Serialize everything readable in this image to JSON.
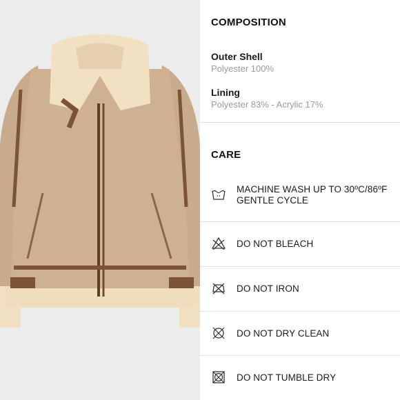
{
  "composition": {
    "title": "COMPOSITION",
    "items": [
      {
        "label": "Outer Shell",
        "value": "Polyester 100%"
      },
      {
        "label": "Lining",
        "value": "Polyester 83% - Acrylic 17%"
      }
    ]
  },
  "care": {
    "title": "CARE",
    "items": [
      {
        "icon": "machine-wash-30-icon",
        "line1": "MACHINE WASH UP TO 30ºC/86ºF",
        "line2": "GENTLE CYCLE"
      },
      {
        "icon": "do-not-bleach-icon",
        "line1": "DO NOT BLEACH"
      },
      {
        "icon": "do-not-iron-icon",
        "line1": "DO NOT IRON"
      },
      {
        "icon": "do-not-dry-clean-icon",
        "line1": "DO NOT DRY CLEAN"
      },
      {
        "icon": "do-not-tumble-dry-icon",
        "line1": "DO NOT TUMBLE DRY"
      }
    ]
  },
  "product_image": {
    "subject": "suede aviator jacket with shearling collar"
  }
}
